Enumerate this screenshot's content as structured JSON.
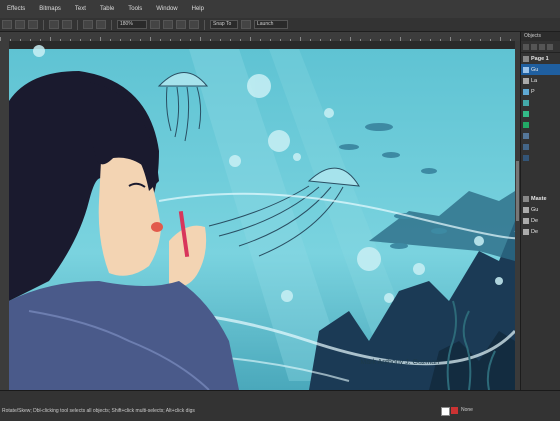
{
  "menu": {
    "items": [
      "Effects",
      "Bitmaps",
      "Text",
      "Table",
      "Tools",
      "Window",
      "Help"
    ]
  },
  "toolbar": {
    "zoom": "180%",
    "snap_to": "Snap To",
    "launch": "Launch"
  },
  "panel": {
    "title": "Objects",
    "rows": [
      {
        "label": "Page 1",
        "type": "header"
      },
      {
        "label": "Gu",
        "selected": true
      },
      {
        "label": "La"
      },
      {
        "label": "P"
      },
      {
        "label": ""
      },
      {
        "label": ""
      },
      {
        "label": ""
      },
      {
        "label": ""
      },
      {
        "label": ""
      },
      {
        "label": ""
      },
      {
        "label": "Maste",
        "type": "header"
      },
      {
        "label": "Gu"
      },
      {
        "label": "De"
      },
      {
        "label": "De"
      }
    ]
  },
  "canvas": {
    "signature": "Mark Anthony J. Guzman"
  },
  "status": {
    "hint": "Rotate/Skew; Dbl-clicking tool selects all objects; Shift+click multi-selects; Alt+click digs",
    "fill": "None"
  },
  "colors": {
    "sky": "#64c4d4",
    "sea_dark": "#1b3a55",
    "girl_hair": "#1a1a2e",
    "skin": "#f3d4b3",
    "shirt": "#4a5a8a",
    "selection": "#1f5fa0"
  }
}
